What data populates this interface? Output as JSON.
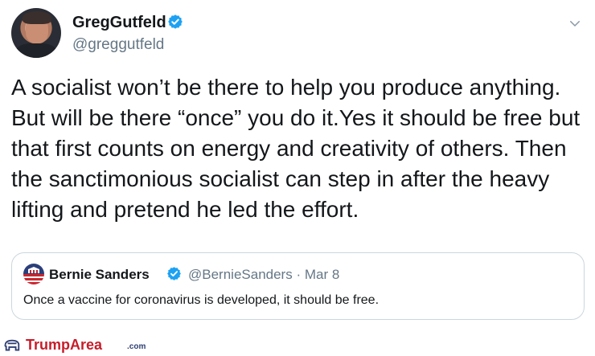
{
  "tweet": {
    "author_name": "GregGutfeld",
    "author_handle": "@greggutfeld",
    "text": "A socialist won’t be there to help you produce anything.\nBut will be there “once” you do it.Yes it should be free but\nthat first counts on energy and creativity of others. Then\nthe sanctimonious socialist can step in after the heavy\nlifting and pretend he led the effort."
  },
  "quoted_tweet": {
    "author_name": "Bernie Sanders",
    "author_handle_and_date": "@BernieSanders · Mar 8",
    "text": "Once a vaccine for coronavirus is developed, it should be free."
  },
  "watermark": {
    "brand": "TrumpArea",
    "tld": ".com"
  },
  "colors": {
    "verified_blue": "#1da1f2",
    "muted_text": "#657786",
    "watermark_red": "#c61d2a",
    "watermark_navy": "#2f3f73"
  },
  "icons": {
    "verified": "verified-badge-icon",
    "chevron": "chevron-down-icon"
  }
}
